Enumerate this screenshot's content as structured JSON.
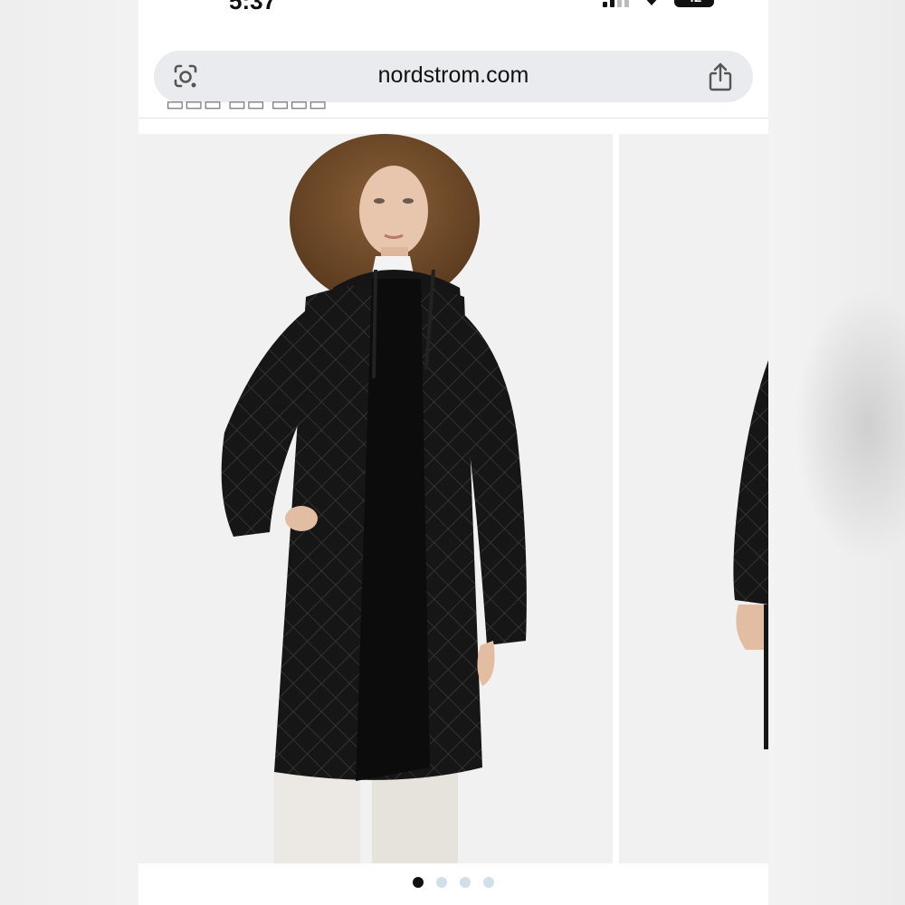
{
  "status_bar": {
    "time": "5:37",
    "battery": "42"
  },
  "browser": {
    "url": "nordstrom.com",
    "lens_icon": "camera-lens-icon",
    "share_icon": "share-icon"
  },
  "gallery": {
    "image_count": 4,
    "active_index": 0
  },
  "colors": {
    "coat": "#141414",
    "background": "#f1f1f1",
    "dot_active": "#111111",
    "dot_inactive": "#cfe0e6"
  }
}
